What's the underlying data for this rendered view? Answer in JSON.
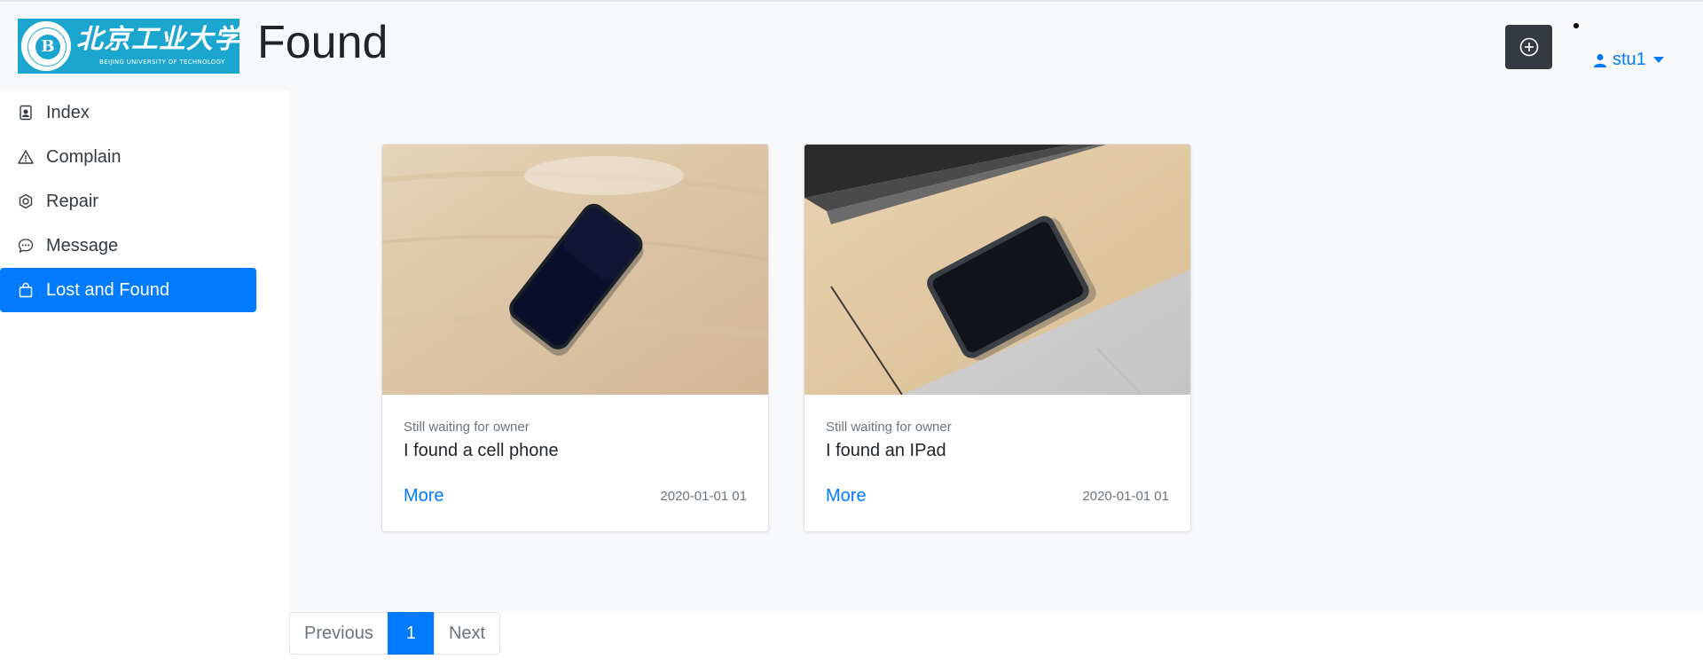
{
  "header": {
    "page_title": "Found",
    "logo": {
      "emblem_letter": "B",
      "cn_text": "北京工业大学",
      "en_text": "BEIJING UNIVERSITY OF TECHNOLOGY"
    },
    "add_icon": "plus-circle-icon",
    "user": {
      "icon": "person-icon",
      "name": "stu1"
    }
  },
  "sidebar": {
    "items": [
      {
        "label": "Index",
        "icon": "person-badge-icon",
        "active": false
      },
      {
        "label": "Complain",
        "icon": "warning-triangle-icon",
        "active": false
      },
      {
        "label": "Repair",
        "icon": "hexagon-bolt-icon",
        "active": false
      },
      {
        "label": "Message",
        "icon": "chat-dots-icon",
        "active": false
      },
      {
        "label": "Lost and Found",
        "icon": "bag-icon",
        "active": true
      }
    ]
  },
  "cards": [
    {
      "status": "Still waiting for owner",
      "title": "I found a cell phone",
      "more_label": "More",
      "date": "2020-01-01 01",
      "image": "phone-on-desk-photo"
    },
    {
      "status": "Still waiting for owner",
      "title": "I found an IPad",
      "more_label": "More",
      "date": "2020-01-01 01",
      "image": "tablet-on-desk-photo"
    }
  ],
  "pagination": {
    "previous_label": "Previous",
    "current_page": "1",
    "next_label": "Next"
  },
  "colors": {
    "primary": "#007bff",
    "dark_button": "#343a40",
    "logo_blue": "#1aa6cf",
    "background": "#f8f9fa"
  }
}
